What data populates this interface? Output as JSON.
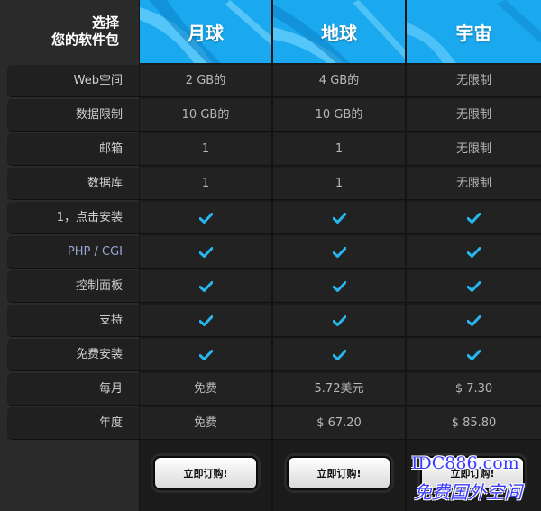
{
  "header": {
    "choose_line1": "选择",
    "choose_line2": "您的软件包",
    "plans": [
      "月球",
      "地球",
      "宇宙"
    ],
    "accent_color": "#1aa9ef"
  },
  "features": [
    {
      "label": "Web空间",
      "values": [
        "2 GB的",
        "4 GB的",
        "无限制"
      ]
    },
    {
      "label": "数据限制",
      "values": [
        "10 GB的",
        "10 GB的",
        "无限制"
      ]
    },
    {
      "label": "邮箱",
      "values": [
        "1",
        "1",
        "无限制"
      ]
    },
    {
      "label": "数据库",
      "values": [
        "1",
        "1",
        "无限制"
      ]
    },
    {
      "label": "1，点击安装",
      "values": [
        "check",
        "check",
        "check"
      ]
    },
    {
      "label": "PHP / CGI",
      "values": [
        "check",
        "check",
        "check"
      ]
    },
    {
      "label": "控制面板",
      "values": [
        "check",
        "check",
        "check"
      ]
    },
    {
      "label": "支持",
      "values": [
        "check",
        "check",
        "check"
      ]
    },
    {
      "label": "免费安装",
      "values": [
        "check",
        "check",
        "check"
      ]
    },
    {
      "label": "每月",
      "values": [
        "免费",
        "5.72美元",
        "$ 7.30"
      ]
    },
    {
      "label": "年度",
      "values": [
        "免费",
        "$ 67.20",
        "$ 85.80"
      ]
    }
  ],
  "buttons": {
    "order_label": "立即订购!"
  },
  "watermark": {
    "line1": "IDC886.com",
    "line2": "免费国外空间"
  },
  "icons": {
    "check": "check-icon"
  },
  "check_color": "#27b6ee"
}
